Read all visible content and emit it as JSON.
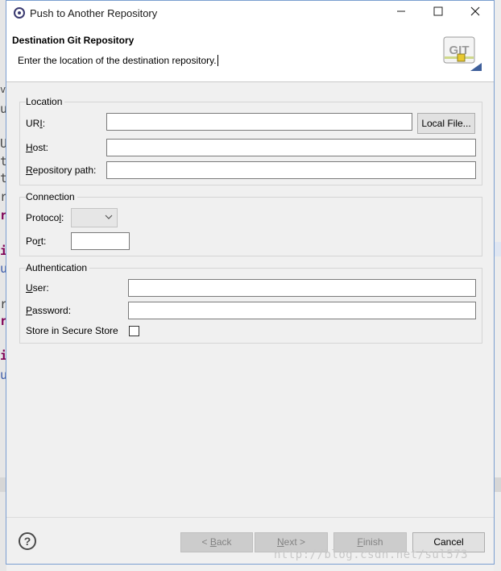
{
  "window": {
    "title": "Push to Another Repository",
    "icon": "eclipse-icon",
    "controls": {
      "minimize": "—",
      "maximize": "☐",
      "close": "✕"
    }
  },
  "header": {
    "title": "Destination Git Repository",
    "description": "Enter the location of the destination repository.",
    "logo_text": "GIT"
  },
  "location": {
    "group_label": "Location",
    "uri_label_pre": "UR",
    "uri_label_mn": "I",
    "uri_label_post": ":",
    "uri_value": "",
    "local_file_button": "Local File...",
    "host_label_mn": "H",
    "host_label_post": "ost:",
    "host_value": "",
    "repo_label_mn": "R",
    "repo_label_post": "epository path:",
    "repo_value": ""
  },
  "connection": {
    "group_label": "Connection",
    "protocol_label_pre": "Protoco",
    "protocol_label_mn": "l",
    "protocol_label_post": ":",
    "protocol_value": "",
    "port_label_pre": "Po",
    "port_label_mn": "r",
    "port_label_post": "t:",
    "port_value": ""
  },
  "authentication": {
    "group_label": "Authentication",
    "user_label_mn": "U",
    "user_label_post": "ser:",
    "user_value": "",
    "password_label_mn": "P",
    "password_label_post": "assword:",
    "password_value": "",
    "store_label": "Store in Secure Store",
    "store_checked": false
  },
  "footer": {
    "back_pre": "< ",
    "back_mn": "B",
    "back_post": "ack",
    "next_mn": "N",
    "next_post": "ext >",
    "finish_mn": "F",
    "finish_post": "inish",
    "cancel": "Cancel"
  },
  "watermark": "http://blog.csdn.net/sul573",
  "colors": {
    "window_border": "#7a9ed0",
    "disabled_button": "#cccccc",
    "editor_keyword": "#7f0055",
    "editor_text": "#3a58a6"
  }
}
